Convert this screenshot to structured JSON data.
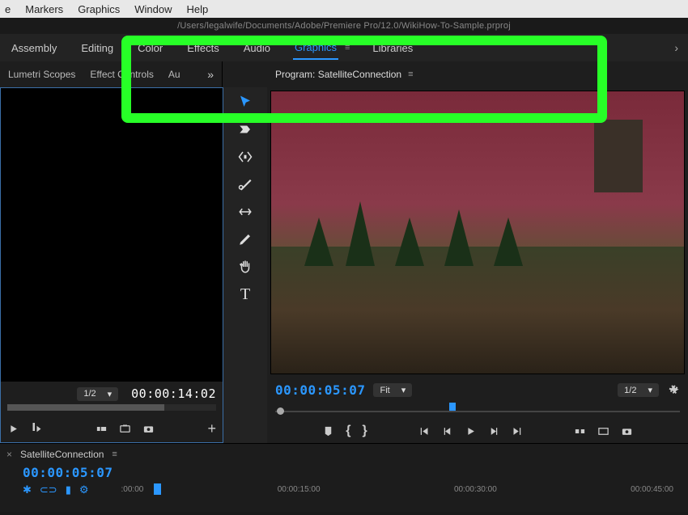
{
  "menubar": {
    "items": [
      "e",
      "Markers",
      "Graphics",
      "Window",
      "Help"
    ]
  },
  "filepath": "/Users/legalwife/Documents/Adobe/Premiere Pro/12.0/WikiHow-To-Sample.prproj",
  "workspaces": {
    "assembly": "Assembly",
    "editing": "Editing",
    "color": "Color",
    "effects": "Effects",
    "audio": "Audio",
    "graphics": "Graphics",
    "libraries": "Libraries"
  },
  "source_tabs": {
    "lumetri": "Lumetri Scopes",
    "effect_ctrl": "Effect Controls",
    "audio": "Au",
    "overflow": "»"
  },
  "program_tab": {
    "prefix": "Program: ",
    "name": "SatelliteConnection"
  },
  "source_panel": {
    "zoom": "1/2",
    "timecode": "00:00:14:02"
  },
  "program_panel": {
    "timecode": "00:00:05:07",
    "fit": "Fit",
    "zoom": "1/2"
  },
  "timeline": {
    "seq_name": "SatelliteConnection",
    "timecode": "00:00:05:07",
    "ruler": [
      ":00:00",
      "00:00:15:00",
      "00:00:30:00",
      "00:00:45:00"
    ]
  },
  "icons": {
    "chevron_down": "▾",
    "chevron_right": "›",
    "hamburger": "≡",
    "wrench": "🔧",
    "plus": "+",
    "close": "×"
  }
}
